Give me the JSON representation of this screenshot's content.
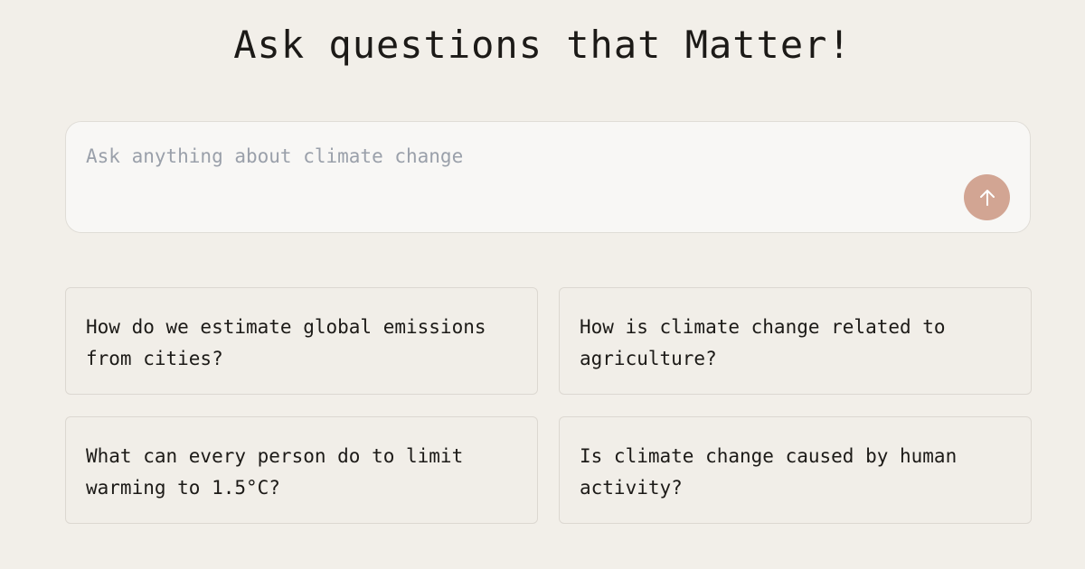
{
  "title": "Ask questions that Matter!",
  "search": {
    "placeholder": "Ask anything about climate change",
    "value": "",
    "submit_icon": "arrow-up-icon",
    "submit_color": "#d2a593"
  },
  "suggestions": [
    {
      "text": "How do we estimate global emissions from cities?"
    },
    {
      "text": "How is climate change related to agriculture?"
    },
    {
      "text": "What can every person do to limit warming to 1.5°C?"
    },
    {
      "text": "Is climate change caused by human activity?"
    }
  ],
  "colors": {
    "background": "#f2efe9",
    "input_background": "#f8f7f5",
    "text": "#1c1a17",
    "placeholder": "#9aa0aa"
  }
}
